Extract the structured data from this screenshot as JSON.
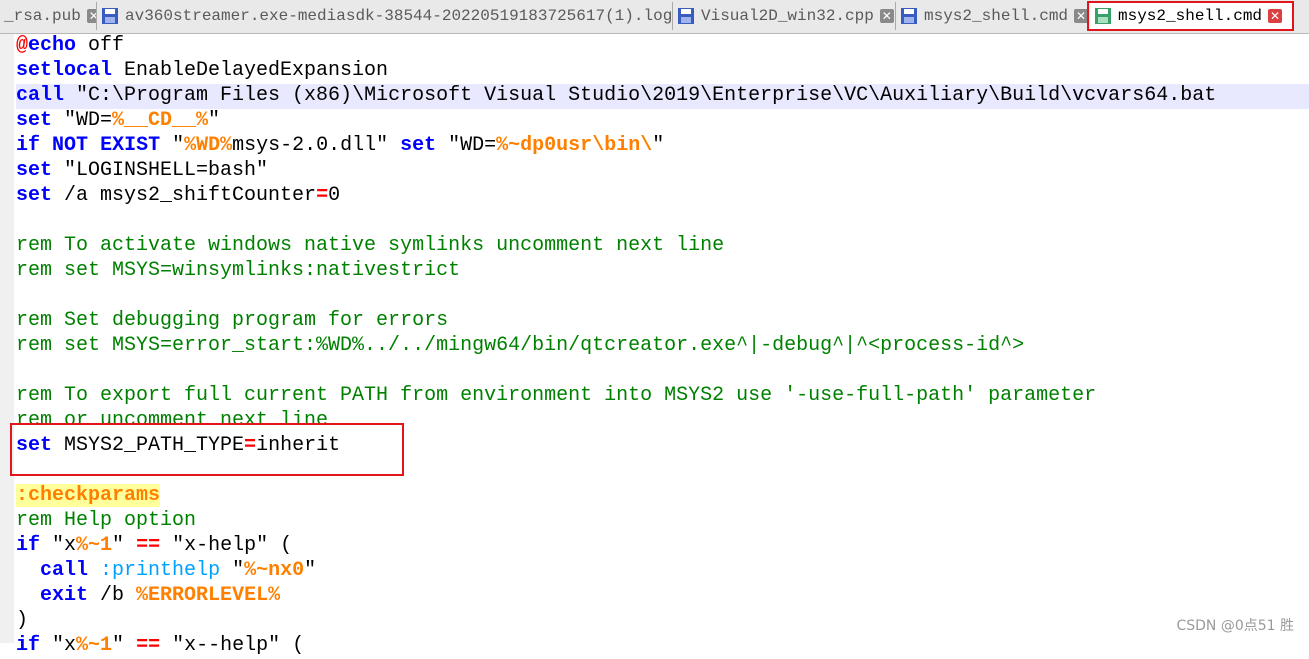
{
  "tabs": [
    {
      "label": "_rsa.pub",
      "active": false
    },
    {
      "label": "av360streamer.exe-mediasdk-38544-20220519183725617(1).log",
      "active": false
    },
    {
      "label": "Visual2D_win32.cpp",
      "active": false
    },
    {
      "label": "msys2_shell.cmd",
      "active": false
    },
    {
      "label": "msys2_shell.cmd",
      "active": true
    }
  ],
  "code": {
    "l1a": "@",
    "l1b": "echo",
    "l1c": " off",
    "l2a": "setlocal",
    "l2b": " EnableDelayedExpansion",
    "l3a": "call",
    "l3b": " \"C:\\Program Files (x86)\\Microsoft Visual Studio\\2019\\Enterprise\\VC\\Auxiliary\\Build\\vcvars64.bat",
    "l4a": "set",
    "l4b": " \"WD=",
    "l4c": "%__CD__%",
    "l4d": "\"",
    "l5a": "if",
    "l5b": " ",
    "l5c": "NOT",
    "l5d": " ",
    "l5e": "EXIST",
    "l5f": " \"",
    "l5g": "%WD%",
    "l5h": "msys-2.0.dll\" ",
    "l5i": "set",
    "l5j": " \"WD=",
    "l5k": "%~dp0usr\\bin\\",
    "l5l": "\"",
    "l6a": "set",
    "l6b": " \"LOGINSHELL=bash\"",
    "l7a": "set",
    "l7b": " /a msys2_shiftCounter",
    "l7c": "=",
    "l7d": "0",
    "l9": "rem To activate windows native symlinks uncomment next line",
    "l10": "rem set MSYS=winsymlinks:nativestrict",
    "l12": "rem Set debugging program for errors",
    "l13": "rem set MSYS=error_start:%WD%../../mingw64/bin/qtcreator.exe^|-debug^|^<process-id^>",
    "l15": "rem To export full current PATH from environment into MSYS2 use '-use-full-path' parameter",
    "l16": "rem or uncomment next line",
    "l17a": "set",
    "l17b": " MSYS2_PATH_TYPE",
    "l17c": "=",
    "l17d": "inherit",
    "l19": ":checkparams",
    "l20": "rem Help option",
    "l21a": "if",
    "l21b": " \"x",
    "l21c": "%~1",
    "l21d": "\" ",
    "l21e": "==",
    "l21f": " \"x-help\" (",
    "l22a": "  ",
    "l22b": "call",
    "l22c": " ",
    "l22d": ":printhelp",
    "l22e": " \"",
    "l22f": "%~nx0",
    "l22g": "\"",
    "l23a": "  ",
    "l23b": "exit",
    "l23c": " /b ",
    "l23d": "%ERRORLEVEL%",
    "l24": ")",
    "l25a": "if",
    "l25b": " \"x",
    "l25c": "%~1",
    "l25d": "\" ",
    "l25e": "==",
    "l25f": " \"x--help\" ("
  },
  "watermark": "CSDN @0点51 胜",
  "colors": {
    "keyword": "#0000ff",
    "variable": "#ff8000",
    "comment": "#008000",
    "highlight": "#e0161b"
  }
}
